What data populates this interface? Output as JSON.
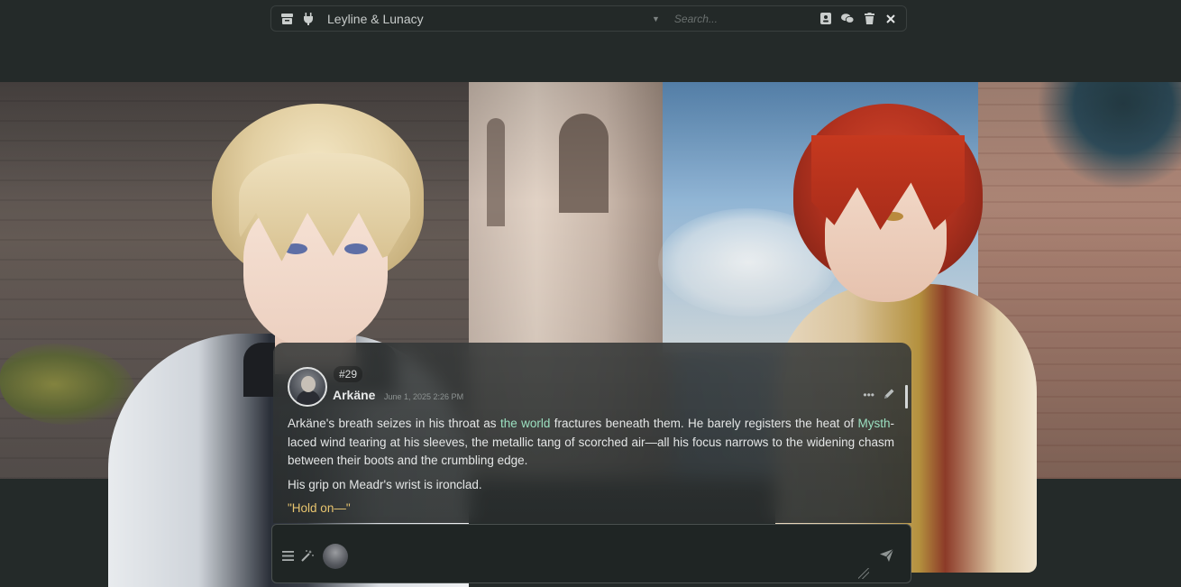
{
  "topbar": {
    "title": "Leyline & Lunacy",
    "search_placeholder": "Search...",
    "left_icons": [
      "archive-icon",
      "plug-icon"
    ],
    "right_icons": [
      "contact-card-icon",
      "chats-icon",
      "trash-icon",
      "close-icon"
    ]
  },
  "message": {
    "id": "#29",
    "name": "Arkäne",
    "timestamp": "June 1, 2025 2:26 PM",
    "paragraphs": [
      {
        "parts": [
          {
            "text": "Arkäne's breath seizes in his throat as ",
            "style": "normal"
          },
          {
            "text": "the world",
            "style": "highlight"
          },
          {
            "text": " fractures beneath them. He barely registers the heat of ",
            "style": "normal"
          },
          {
            "text": "Mysth",
            "style": "highlight"
          },
          {
            "text": "-laced wind tearing at his sleeves, the metallic tang of scorched air—all his focus narrows to the widening chasm between their boots and the crumbling edge.",
            "style": "normal"
          }
        ]
      },
      {
        "parts": [
          {
            "text": "His grip on Meadr's wrist is ironclad.",
            "style": "normal"
          }
        ]
      },
      {
        "parts": [
          {
            "text": "\"Hold on—\"",
            "style": "quote"
          }
        ]
      }
    ]
  },
  "colors": {
    "background": "#232827",
    "highlight": "#9be0c0",
    "quote": "#e8c56f",
    "text": "#e4e6e6"
  }
}
